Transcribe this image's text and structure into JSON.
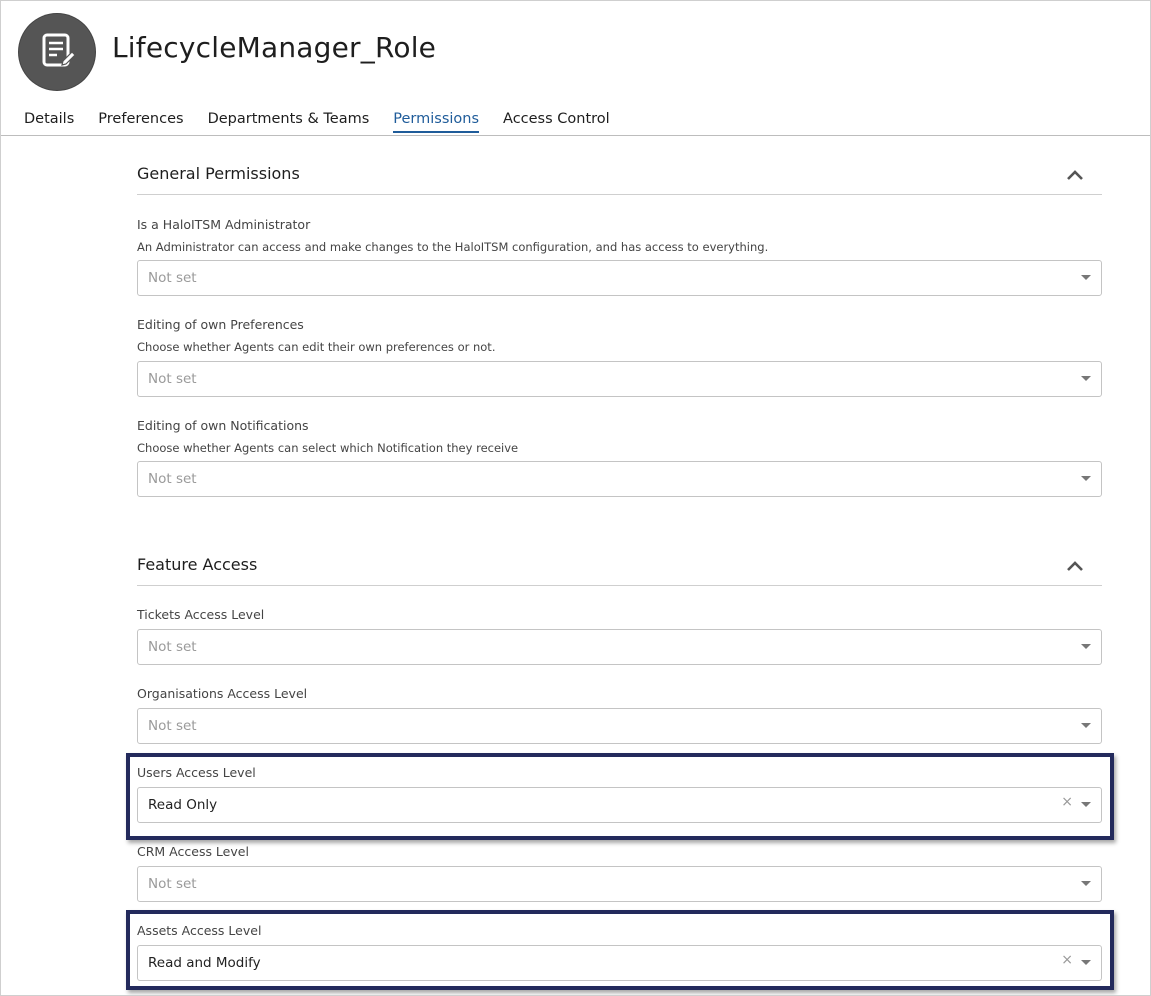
{
  "header": {
    "title": "LifecycleManager_Role",
    "avatar_icon": "document-edit-icon"
  },
  "tabs": [
    {
      "label": "Details",
      "active": false
    },
    {
      "label": "Preferences",
      "active": false
    },
    {
      "label": "Departments & Teams",
      "active": false
    },
    {
      "label": "Permissions",
      "active": true
    },
    {
      "label": "Access Control",
      "active": false
    }
  ],
  "colors": {
    "accent": "#1f5c9a",
    "highlight_border": "#232a5c",
    "avatar_bg": "#555555"
  },
  "general_permissions": {
    "title": "General Permissions",
    "fields": [
      {
        "label": "Is a HaloITSM Administrator",
        "description": "An Administrator can access and make changes to the HaloITSM configuration, and has access to everything.",
        "value": "Not set"
      },
      {
        "label": "Editing of own Preferences",
        "description": "Choose whether Agents can edit their own preferences or not.",
        "value": "Not set"
      },
      {
        "label": "Editing of own Notifications",
        "description": "Choose whether Agents can select which Notification they receive",
        "value": "Not set"
      }
    ]
  },
  "feature_access": {
    "title": "Feature Access",
    "fields": [
      {
        "label": "Tickets Access Level",
        "value": "Not set"
      },
      {
        "label": "Organisations Access Level",
        "value": "Not set"
      },
      {
        "label": "Users Access Level",
        "value": "Read Only",
        "clear": "×"
      },
      {
        "label": "CRM Access Level",
        "value": "Not set"
      },
      {
        "label": "Assets Access Level",
        "value": "Read and Modify",
        "clear": "×"
      }
    ]
  }
}
